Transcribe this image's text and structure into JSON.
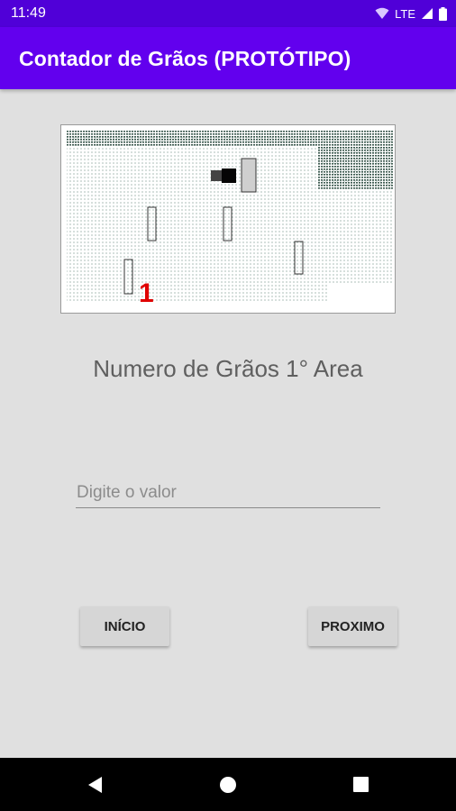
{
  "status_bar": {
    "time": "11:49",
    "network_label": "LTE",
    "icons": [
      "wifi-icon",
      "signal-icon",
      "battery-icon"
    ]
  },
  "app_bar": {
    "title": "Contador de Grãos (PROTÓTIPO)",
    "color": "#6200ee"
  },
  "main": {
    "image_label": "1",
    "section_title": "Numero de Grãos 1° Area",
    "input": {
      "placeholder": "Digite o valor",
      "value": ""
    },
    "buttons": {
      "start_label": "INÍCIO",
      "next_label": "PROXIMO"
    }
  },
  "nav_bar": {
    "icons": [
      "back-icon",
      "home-icon",
      "recents-icon"
    ]
  }
}
